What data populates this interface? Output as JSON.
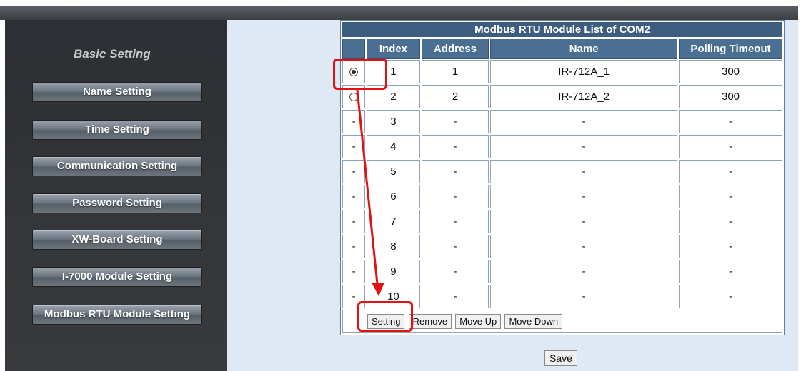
{
  "sidebar": {
    "title": "Basic Setting",
    "items": [
      {
        "label": "Name Setting"
      },
      {
        "label": "Time Setting"
      },
      {
        "label": "Communication Setting"
      },
      {
        "label": "Password Setting"
      },
      {
        "label": "XW-Board Setting"
      },
      {
        "label": "I-7000 Module Setting"
      },
      {
        "label": "Modbus RTU Module Setting"
      }
    ]
  },
  "table": {
    "caption": "Modbus RTU Module List of COM2",
    "columns": [
      "Index",
      "Address",
      "Name",
      "Polling Timeout"
    ],
    "rows": [
      {
        "select": "radio-checked",
        "index": "1",
        "address": "1",
        "name": "IR-712A_1",
        "timeout": "300"
      },
      {
        "select": "radio",
        "index": "2",
        "address": "2",
        "name": "IR-712A_2",
        "timeout": "300"
      },
      {
        "select": "-",
        "index": "3",
        "address": "-",
        "name": "-",
        "timeout": "-"
      },
      {
        "select": "-",
        "index": "4",
        "address": "-",
        "name": "-",
        "timeout": "-"
      },
      {
        "select": "-",
        "index": "5",
        "address": "-",
        "name": "-",
        "timeout": "-"
      },
      {
        "select": "-",
        "index": "6",
        "address": "-",
        "name": "-",
        "timeout": "-"
      },
      {
        "select": "-",
        "index": "7",
        "address": "-",
        "name": "-",
        "timeout": "-"
      },
      {
        "select": "-",
        "index": "8",
        "address": "-",
        "name": "-",
        "timeout": "-"
      },
      {
        "select": "-",
        "index": "9",
        "address": "-",
        "name": "-",
        "timeout": "-"
      },
      {
        "select": "-",
        "index": "10",
        "address": "-",
        "name": "-",
        "timeout": "-"
      }
    ]
  },
  "actions": {
    "setting": "Setting",
    "remove": "Remove",
    "move_up": "Move Up",
    "move_down": "Move Down"
  },
  "save_label": "Save",
  "colors": {
    "highlight": "#e21212",
    "header": "#4a6f92",
    "sidebar": "#2c2f33",
    "main_bg": "#dfe9f5"
  }
}
